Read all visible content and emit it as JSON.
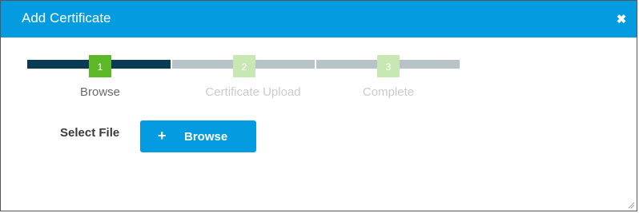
{
  "dialog": {
    "title": "Add Certificate",
    "close_icon": "close-icon"
  },
  "stepper": {
    "current_step": 1,
    "steps": [
      {
        "number": "1",
        "label": "Browse",
        "state": "active"
      },
      {
        "number": "2",
        "label": "Certificate Upload",
        "state": "pending"
      },
      {
        "number": "3",
        "label": "Complete",
        "state": "pending"
      }
    ]
  },
  "form": {
    "select_file_label": "Select File",
    "browse_button_icon": "plus-icon",
    "browse_button_label": "Browse"
  },
  "colors": {
    "titlebar": "#049be0",
    "button": "#049be0",
    "step_completed_bar": "#0b3a54",
    "step_pending_bar": "#b7c3c8",
    "step_active_badge": "#5cb825",
    "step_pending_badge": "#c8e8b3"
  }
}
